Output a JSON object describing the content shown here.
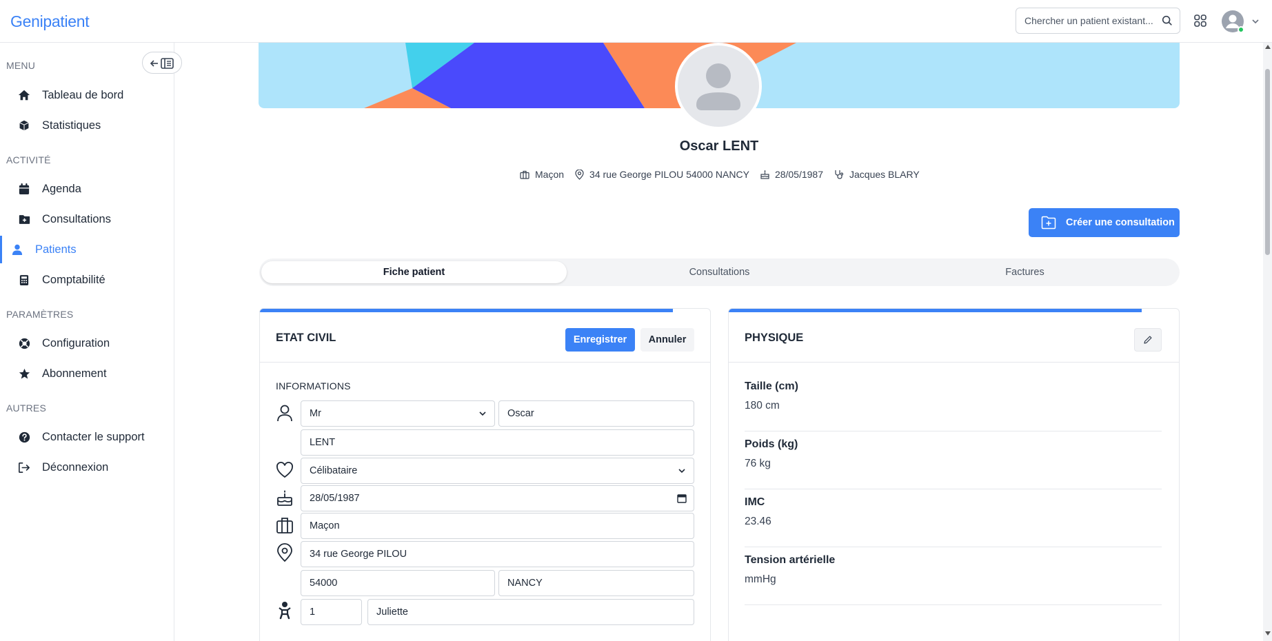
{
  "app": {
    "logo": "Genipatient"
  },
  "topbar": {
    "search_placeholder": "Chercher un patient existant..."
  },
  "sidebar": {
    "sections": {
      "menu": "MENU",
      "activity": "ACTIVITÉ",
      "settings": "PARAMÈTRES",
      "others": "AUTRES"
    },
    "items": [
      {
        "label": "Tableau de bord",
        "icon": "home-icon"
      },
      {
        "label": "Statistiques",
        "icon": "cube-icon"
      },
      {
        "label": "Agenda",
        "icon": "calendar-icon"
      },
      {
        "label": "Consultations",
        "icon": "folder-plus-icon"
      },
      {
        "label": "Patients",
        "icon": "user-icon",
        "active": true
      },
      {
        "label": "Comptabilité",
        "icon": "calculator-icon"
      },
      {
        "label": "Configuration",
        "icon": "lifebuoy-icon"
      },
      {
        "label": "Abonnement",
        "icon": "star-icon"
      },
      {
        "label": "Contacter le support",
        "icon": "question-circle-icon"
      },
      {
        "label": "Déconnexion",
        "icon": "logout-icon"
      }
    ]
  },
  "patient": {
    "name": "Oscar LENT",
    "profession": "Maçon",
    "address": "34 rue George PILOU 54000 NANCY",
    "birthdate": "28/05/1987",
    "doctor": "Jacques BLARY"
  },
  "actions": {
    "create_consultation": "Créer une consultation"
  },
  "tabs": [
    "Fiche patient",
    "Consultations",
    "Factures"
  ],
  "etat_civil": {
    "title": "ETAT CIVIL",
    "save": "Enregistrer",
    "cancel": "Annuler",
    "section": "INFORMATIONS",
    "civility": "Mr",
    "firstname": "Oscar",
    "lastname": "LENT",
    "marital_status": "Célibataire",
    "birthdate": "28/05/1987",
    "profession": "Maçon",
    "street": "34 rue George PILOU",
    "zip": "54000",
    "city": "NANCY",
    "children_count": "1",
    "children_names": "Juliette"
  },
  "physique": {
    "title": "PHYSIQUE",
    "items": [
      {
        "label": "Taille (cm)",
        "value": "180 cm"
      },
      {
        "label": "Poids (kg)",
        "value": "76 kg"
      },
      {
        "label": "IMC",
        "value": "23.46"
      },
      {
        "label": "Tension artérielle",
        "value": "mmHg"
      }
    ]
  },
  "colors": {
    "accent": "#3b82f6",
    "banner_bg": "#aee4fb",
    "banner_orange": "#fc8a57",
    "banner_indigo": "#4a4afc",
    "banner_cyan": "#43d0ec"
  }
}
